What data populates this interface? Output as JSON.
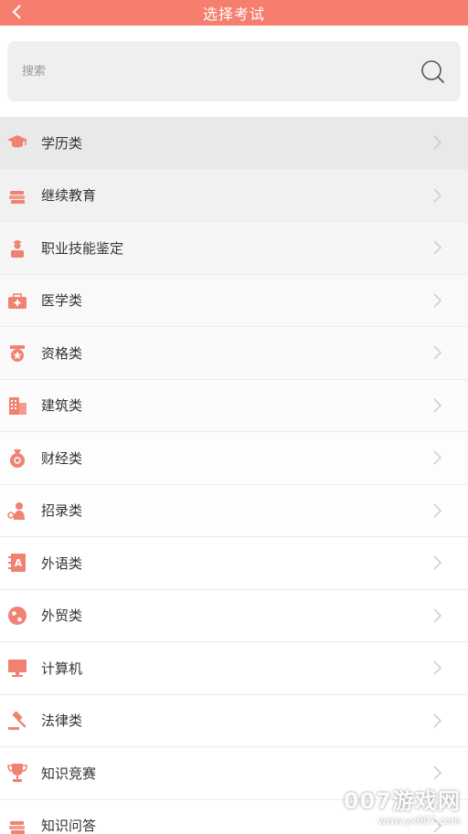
{
  "header": {
    "title": "选择考试"
  },
  "search": {
    "placeholder": "搜索"
  },
  "colors": {
    "accent": "#f67e6e",
    "icon": "#f08272",
    "chevron": "#c8c8c8"
  },
  "categories": [
    {
      "label": "学历类",
      "icon": "graduation-cap-icon",
      "bg": "#e9e9e9"
    },
    {
      "label": "继续教育",
      "icon": "books-icon",
      "bg": "#f1f1f1"
    },
    {
      "label": "职业技能鉴定",
      "icon": "worker-icon",
      "bg": "#f6f6f6"
    },
    {
      "label": "医学类",
      "icon": "medical-kit-icon",
      "bg": "#f9f9f9"
    },
    {
      "label": "资格类",
      "icon": "badge-icon",
      "bg": "#fafafa"
    },
    {
      "label": "建筑类",
      "icon": "building-icon",
      "bg": "#fcfcfc"
    },
    {
      "label": "财经类",
      "icon": "money-bag-icon",
      "bg": "#fdfdfd"
    },
    {
      "label": "招录类",
      "icon": "recruit-icon",
      "bg": "#fefefe"
    },
    {
      "label": "外语类",
      "icon": "language-book-icon",
      "bg": "#ffffff"
    },
    {
      "label": "外贸类",
      "icon": "globe-icon",
      "bg": "#ffffff"
    },
    {
      "label": "计算机",
      "icon": "monitor-icon",
      "bg": "#ffffff"
    },
    {
      "label": "法律类",
      "icon": "gavel-icon",
      "bg": "#ffffff"
    },
    {
      "label": "知识竞赛",
      "icon": "trophy-icon",
      "bg": "#ffffff"
    },
    {
      "label": "知识问答",
      "icon": "qa-books-icon",
      "bg": "#ffffff"
    }
  ],
  "watermark": {
    "main": "007游戏网",
    "sub": "www.yx007.com"
  }
}
